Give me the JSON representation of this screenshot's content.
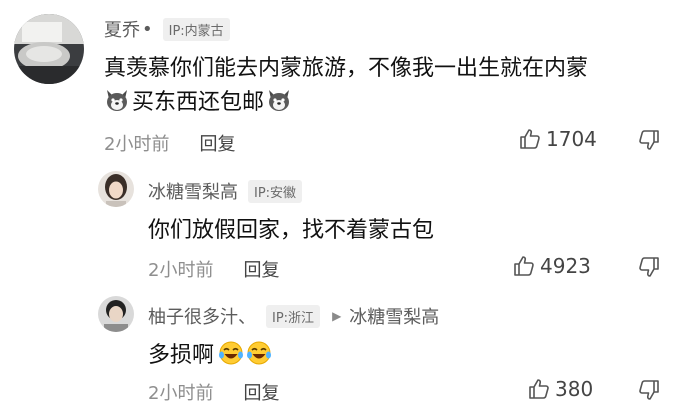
{
  "comments": [
    {
      "username": "夏乔",
      "separator": "•",
      "ip": "IP:内蒙古",
      "text_main": "真羡慕你们能去内蒙旅游，不像我一出生就在内蒙",
      "text_second": "买东西还包邮",
      "time": "2小时前",
      "reply_label": "回复",
      "likes": "1704",
      "emoji": "dog-face-icon"
    },
    {
      "username": "冰糖雪梨高",
      "ip": "IP:安徽",
      "text_main": "你们放假回家，找不着蒙古包",
      "time": "2小时前",
      "reply_label": "回复",
      "likes": "4923"
    },
    {
      "username": "柚子很多汁、",
      "ip": "IP:浙江",
      "reply_to_arrow": "▶",
      "reply_to": "冰糖雪梨高",
      "text_main": "多损啊",
      "time": "2小时前",
      "reply_label": "回复",
      "likes": "380",
      "emoji": "laughing-tears-icon"
    }
  ],
  "icons": {
    "like": "thumbs-up-icon",
    "dislike": "thumbs-down-icon"
  },
  "colors": {
    "username": "#5c5c5c",
    "meta": "#8e8e8e",
    "text": "#111111",
    "ip_tag_bg": "#efefef"
  }
}
